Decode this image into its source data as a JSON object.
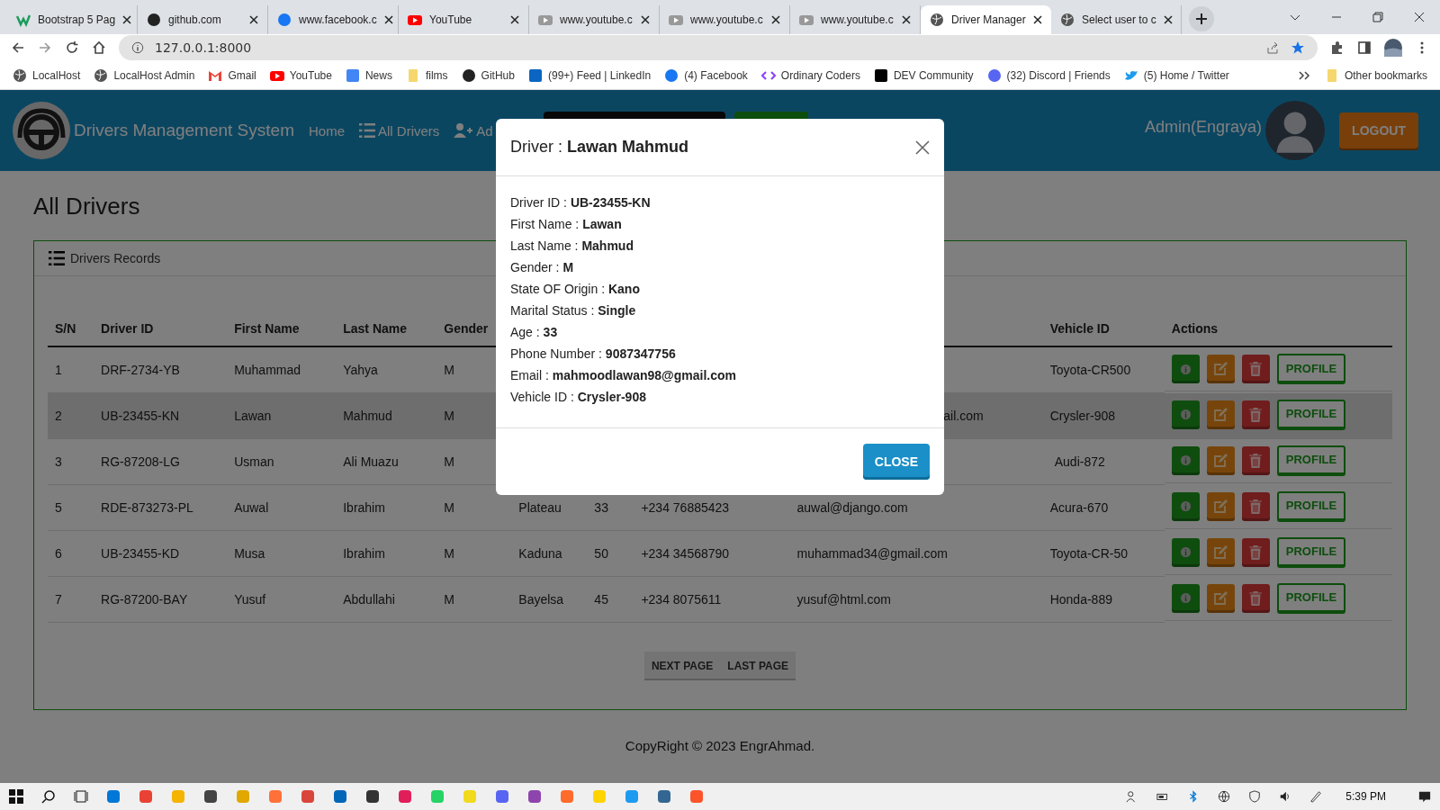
{
  "browser": {
    "tabs": [
      {
        "label": "Bootstrap 5 Pag",
        "kind": "w3",
        "selected": false
      },
      {
        "label": "github.com",
        "kind": "github",
        "selected": false
      },
      {
        "label": "www.facebook.c",
        "kind": "facebook",
        "selected": false
      },
      {
        "label": "YouTube",
        "kind": "youtube",
        "selected": false
      },
      {
        "label": "www.youtube.c",
        "kind": "video",
        "selected": false
      },
      {
        "label": "www.youtube.c",
        "kind": "video",
        "selected": false
      },
      {
        "label": "www.youtube.c",
        "kind": "video",
        "selected": false
      },
      {
        "label": "Driver Manager",
        "kind": "globe",
        "selected": true
      },
      {
        "label": "Select user to c",
        "kind": "globe",
        "selected": false
      }
    ],
    "address": "127.0.0.1:8000",
    "bookmarks": [
      {
        "label": "LocalHost",
        "kind": "globe"
      },
      {
        "label": "LocalHost Admin",
        "kind": "globe"
      },
      {
        "label": "Gmail",
        "kind": "gmail"
      },
      {
        "label": "YouTube",
        "kind": "youtube"
      },
      {
        "label": "News",
        "kind": "news"
      },
      {
        "label": "films",
        "kind": "folder"
      },
      {
        "label": "GitHub",
        "kind": "github"
      },
      {
        "label": "(99+) Feed | LinkedIn",
        "kind": "linkedin"
      },
      {
        "label": "(4) Facebook",
        "kind": "facebook"
      },
      {
        "label": "Ordinary Coders",
        "kind": "code"
      },
      {
        "label": "DEV Community",
        "kind": "dev"
      },
      {
        "label": "(32) Discord | Friends",
        "kind": "discord"
      },
      {
        "label": "(5) Home / Twitter",
        "kind": "twitter"
      }
    ],
    "other_bookmarks": "Other bookmarks"
  },
  "app": {
    "brand": "Drivers Management System",
    "nav": [
      {
        "label": "Home",
        "kind": "plain"
      },
      {
        "label": "All Drivers",
        "kind": "list"
      },
      {
        "label": "Ad",
        "kind": "add-user"
      }
    ],
    "user": "Admin(Engraya)",
    "logout": "LOGOUT"
  },
  "page": {
    "title": "All Drivers",
    "card_title": "Drivers Records",
    "columns": [
      "S/N",
      "Driver ID",
      "First Name",
      "Last Name",
      "Gender",
      null,
      null,
      null,
      null,
      "Vehicle ID",
      "Actions"
    ],
    "rows": [
      {
        "selected": false,
        "cells": [
          "1",
          "DRF-2734-YB",
          "Muhammad",
          "Yahya",
          "M",
          null,
          null,
          null,
          null,
          "Toyota-CR500"
        ]
      },
      {
        "selected": true,
        "cells": [
          "2",
          "UB-23455-KN",
          "Lawan",
          "Mahmud",
          "M",
          null,
          null,
          null,
          "ail.com",
          "Crysler-908"
        ]
      },
      {
        "selected": false,
        "cells": [
          "3",
          "RG-87208-LG",
          "Usman",
          "Ali Muazu",
          "M",
          null,
          null,
          null,
          null,
          "Audi-872"
        ]
      },
      {
        "selected": false,
        "cells": [
          "5",
          "RDE-873273-PL",
          "Auwal",
          "Ibrahim",
          "M",
          "Plateau",
          "33",
          "+234 76885423",
          "auwal@django.com",
          "Acura-670"
        ]
      },
      {
        "selected": false,
        "cells": [
          "6",
          "UB-23455-KD",
          "Musa",
          "Ibrahim",
          "M",
          "Kaduna",
          "50",
          "+234 34568790",
          "muhammad34@gmail.com",
          "Toyota-CR-50"
        ]
      },
      {
        "selected": false,
        "cells": [
          "7",
          "RG-87200-BAY",
          "Yusuf",
          "Abdullahi",
          "M",
          "Bayelsa",
          "45",
          "+234 8075611",
          "yusuf@html.com",
          "Honda-889"
        ]
      }
    ],
    "profile_labels": [
      "PROFILE",
      "PROFILE",
      "PROFILE",
      "PROFILE",
      "PROFILE",
      "PROFILE"
    ],
    "pagination": [
      "NEXT PAGE",
      "LAST PAGE"
    ],
    "footer": "CopyRight © 2023 EngrAhmad."
  },
  "modal": {
    "title_label": "Driver :",
    "title_name": "Lawan Mahmud",
    "fields": [
      {
        "label": "Driver ID :",
        "value": "UB-23455-KN"
      },
      {
        "label": "First Name :",
        "value": "Lawan"
      },
      {
        "label": "Last Name :",
        "value": "Mahmud"
      },
      {
        "label": "Gender :",
        "value": "M"
      },
      {
        "label": "State OF Origin :",
        "value": "Kano"
      },
      {
        "label": "Marital Status :",
        "value": "Single"
      },
      {
        "label": "Age :",
        "value": "33"
      },
      {
        "label": "Phone Number :",
        "value": "9087347756"
      },
      {
        "label": "Email :",
        "value": "mahmoodlawan98@gmail.com"
      },
      {
        "label": "Vehicle ID :",
        "value": "Crysler-908"
      }
    ],
    "close": "CLOSE"
  },
  "taskbar": {
    "time": "5:39 PM"
  }
}
